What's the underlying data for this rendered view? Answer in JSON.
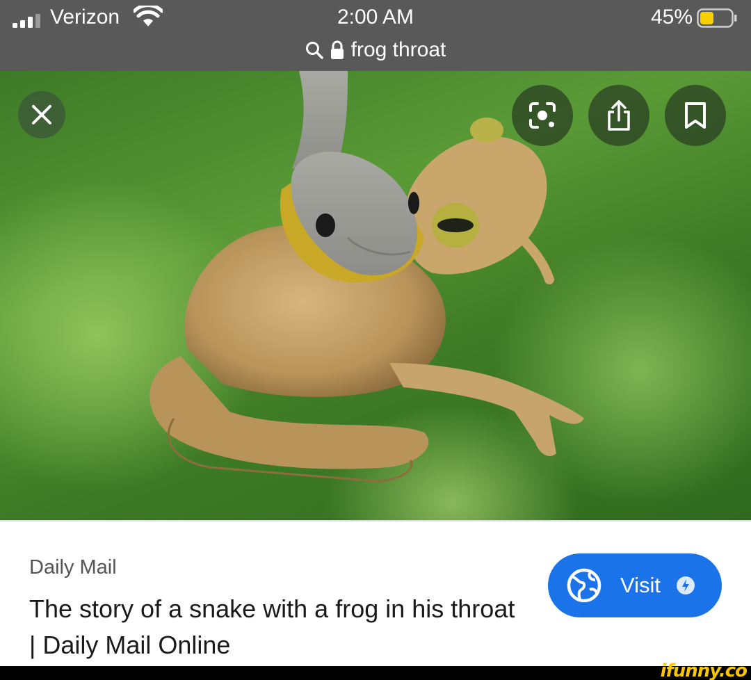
{
  "status_bar": {
    "carrier": "Verizon",
    "time": "2:00 AM",
    "battery_percent": "45%",
    "battery_level": 0.45,
    "battery_color": "#f7d000",
    "signal_icon": "signal-bars-icon",
    "wifi_icon": "wifi-icon"
  },
  "url_bar": {
    "search_icon": "search-icon",
    "lock_icon": "lock-icon",
    "query": "frog throat"
  },
  "image_viewer": {
    "close_icon": "close-icon",
    "actions": [
      {
        "icon": "lens-icon"
      },
      {
        "icon": "share-icon"
      },
      {
        "icon": "bookmark-icon"
      }
    ]
  },
  "result": {
    "source": "Daily Mail",
    "title": "The story of a snake with a frog in his throat | Daily Mail Online",
    "visit_label": "Visit",
    "visit_color": "#1a73e8",
    "globe_icon": "globe-icon",
    "amp_icon": "amp-lightning-icon"
  },
  "watermark": "ifunny.co"
}
